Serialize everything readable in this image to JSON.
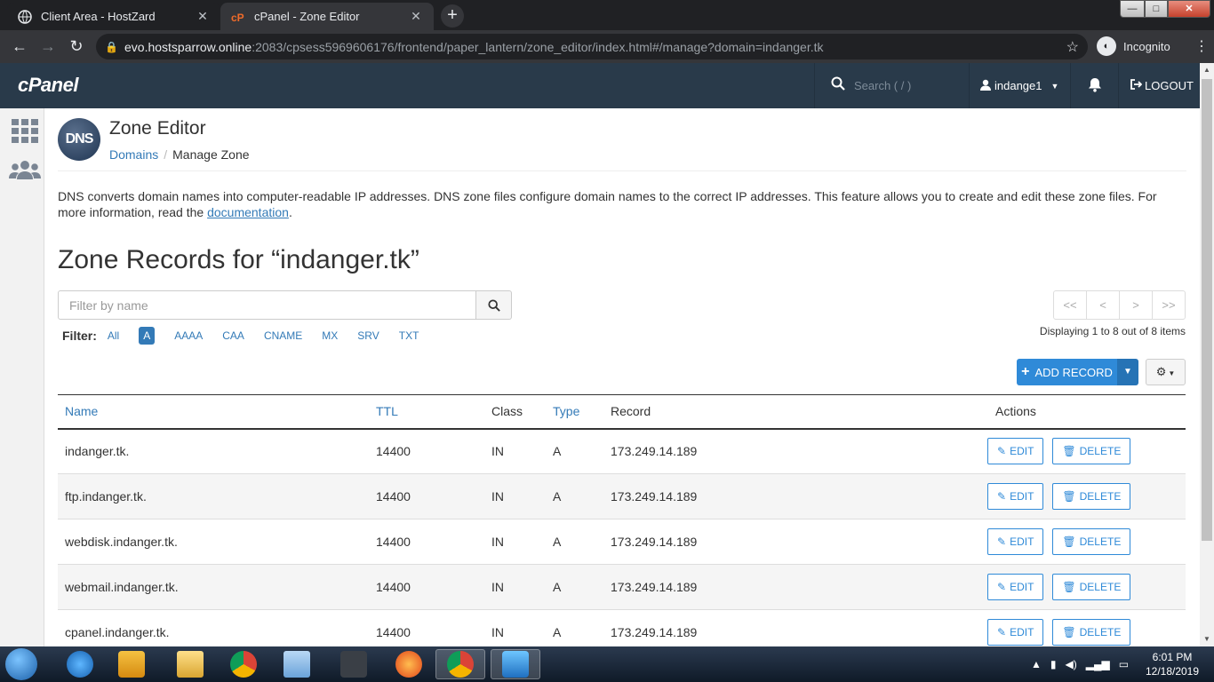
{
  "browser": {
    "tabs": [
      {
        "title": "Client Area - HostZard",
        "active": false
      },
      {
        "title": "cPanel - Zone Editor",
        "active": true
      }
    ],
    "url_host": "evo.hostsparrow.online",
    "url_path": ":2083/cpsess5969606176/frontend/paper_lantern/zone_editor/index.html#/manage?domain=indanger.tk",
    "profile_label": "Incognito"
  },
  "header": {
    "logo": "cPanel",
    "search_placeholder": "Search ( / )",
    "username": "indange1",
    "logout_label": "LOGOUT"
  },
  "page": {
    "title": "Zone Editor",
    "icon_text": "DNS",
    "breadcrumb": {
      "parent": "Domains",
      "current": "Manage Zone"
    },
    "description": "DNS converts domain names into computer-readable IP addresses. DNS zone files configure domain names to the correct IP addresses. This feature allows you to create and edit these zone files. For more information, read the",
    "doc_link": "documentation",
    "zone_title": "Zone Records for “indanger.tk”"
  },
  "filter": {
    "placeholder": "Filter by name",
    "label": "Filter:",
    "options": [
      "All",
      "A",
      "AAAA",
      "CAA",
      "CNAME",
      "MX",
      "SRV",
      "TXT"
    ],
    "selected": "A"
  },
  "pager": {
    "first": "<<",
    "prev": "<",
    "next": ">",
    "last": ">>",
    "status": "Displaying 1 to 8 out of 8 items"
  },
  "actions": {
    "add_record": "ADD RECORD"
  },
  "table": {
    "headers": {
      "name": "Name",
      "ttl": "TTL",
      "class": "Class",
      "type": "Type",
      "record": "Record",
      "actions": "Actions"
    },
    "edit_label": "EDIT",
    "delete_label": "DELETE",
    "rows": [
      {
        "name": "indanger.tk.",
        "ttl": "14400",
        "class": "IN",
        "type": "A",
        "record": "173.249.14.189"
      },
      {
        "name": "ftp.indanger.tk.",
        "ttl": "14400",
        "class": "IN",
        "type": "A",
        "record": "173.249.14.189"
      },
      {
        "name": "webdisk.indanger.tk.",
        "ttl": "14400",
        "class": "IN",
        "type": "A",
        "record": "173.249.14.189"
      },
      {
        "name": "webmail.indanger.tk.",
        "ttl": "14400",
        "class": "IN",
        "type": "A",
        "record": "173.249.14.189"
      },
      {
        "name": "cpanel.indanger.tk.",
        "ttl": "14400",
        "class": "IN",
        "type": "A",
        "record": "173.249.14.189"
      }
    ]
  },
  "taskbar": {
    "time": "6:01 PM",
    "date": "12/18/2019"
  },
  "colors": {
    "header_bg": "#293a4a",
    "link": "#337ab7",
    "primary": "#2f8ad8"
  }
}
